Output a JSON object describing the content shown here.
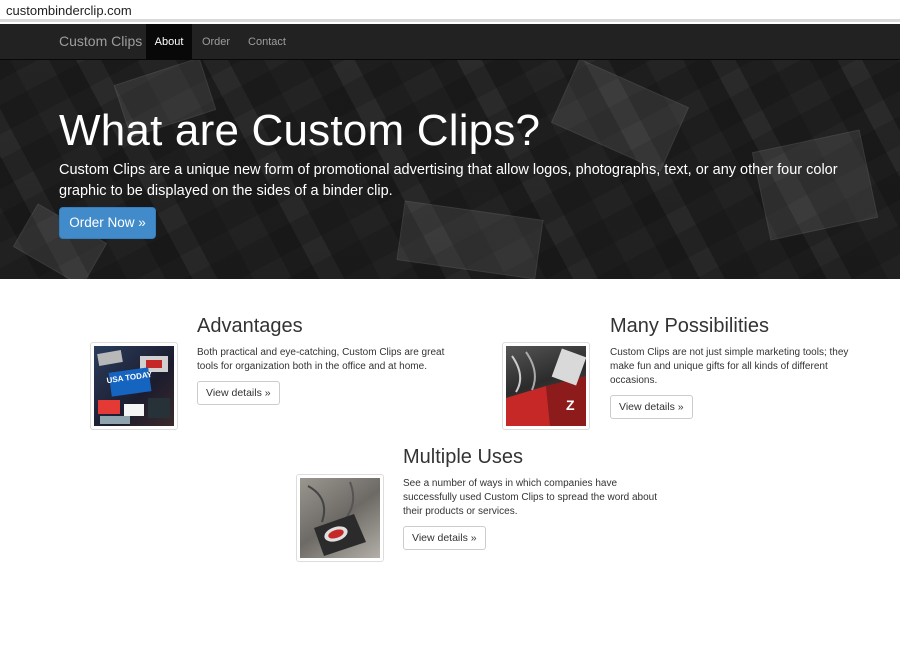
{
  "browser": {
    "url": "custombinderclip.com"
  },
  "navbar": {
    "brand": "Custom Clips",
    "items": [
      {
        "label": "About"
      },
      {
        "label": "Order"
      },
      {
        "label": "Contact"
      }
    ]
  },
  "hero": {
    "title": "What are Custom Clips?",
    "text": "Custom Clips are a unique new form of promotional advertising that allow logos, photographs, text, or any other four color graphic to be displayed on the sides of a binder clip.",
    "button": "Order Now »"
  },
  "features": [
    {
      "title": "Advantages",
      "text": "Both practical and eye-catching, Custom Clips are great tools for organization both in the office and at home.",
      "button": "View details »",
      "image_text": "USA TODAY"
    },
    {
      "title": "Many Possibilities",
      "text": "Custom Clips are not just simple marketing tools; they make fun and unique gifts for all kinds of different occasions.",
      "button": "View details »"
    },
    {
      "title": "Multiple Uses",
      "text": "See a number of ways in which companies have successfully used Custom Clips to spread the word about their products or services.",
      "button": "View details »"
    }
  ],
  "colors": {
    "navbar": "#222222",
    "primary_button": "#428bca",
    "white": "#ffffff"
  }
}
